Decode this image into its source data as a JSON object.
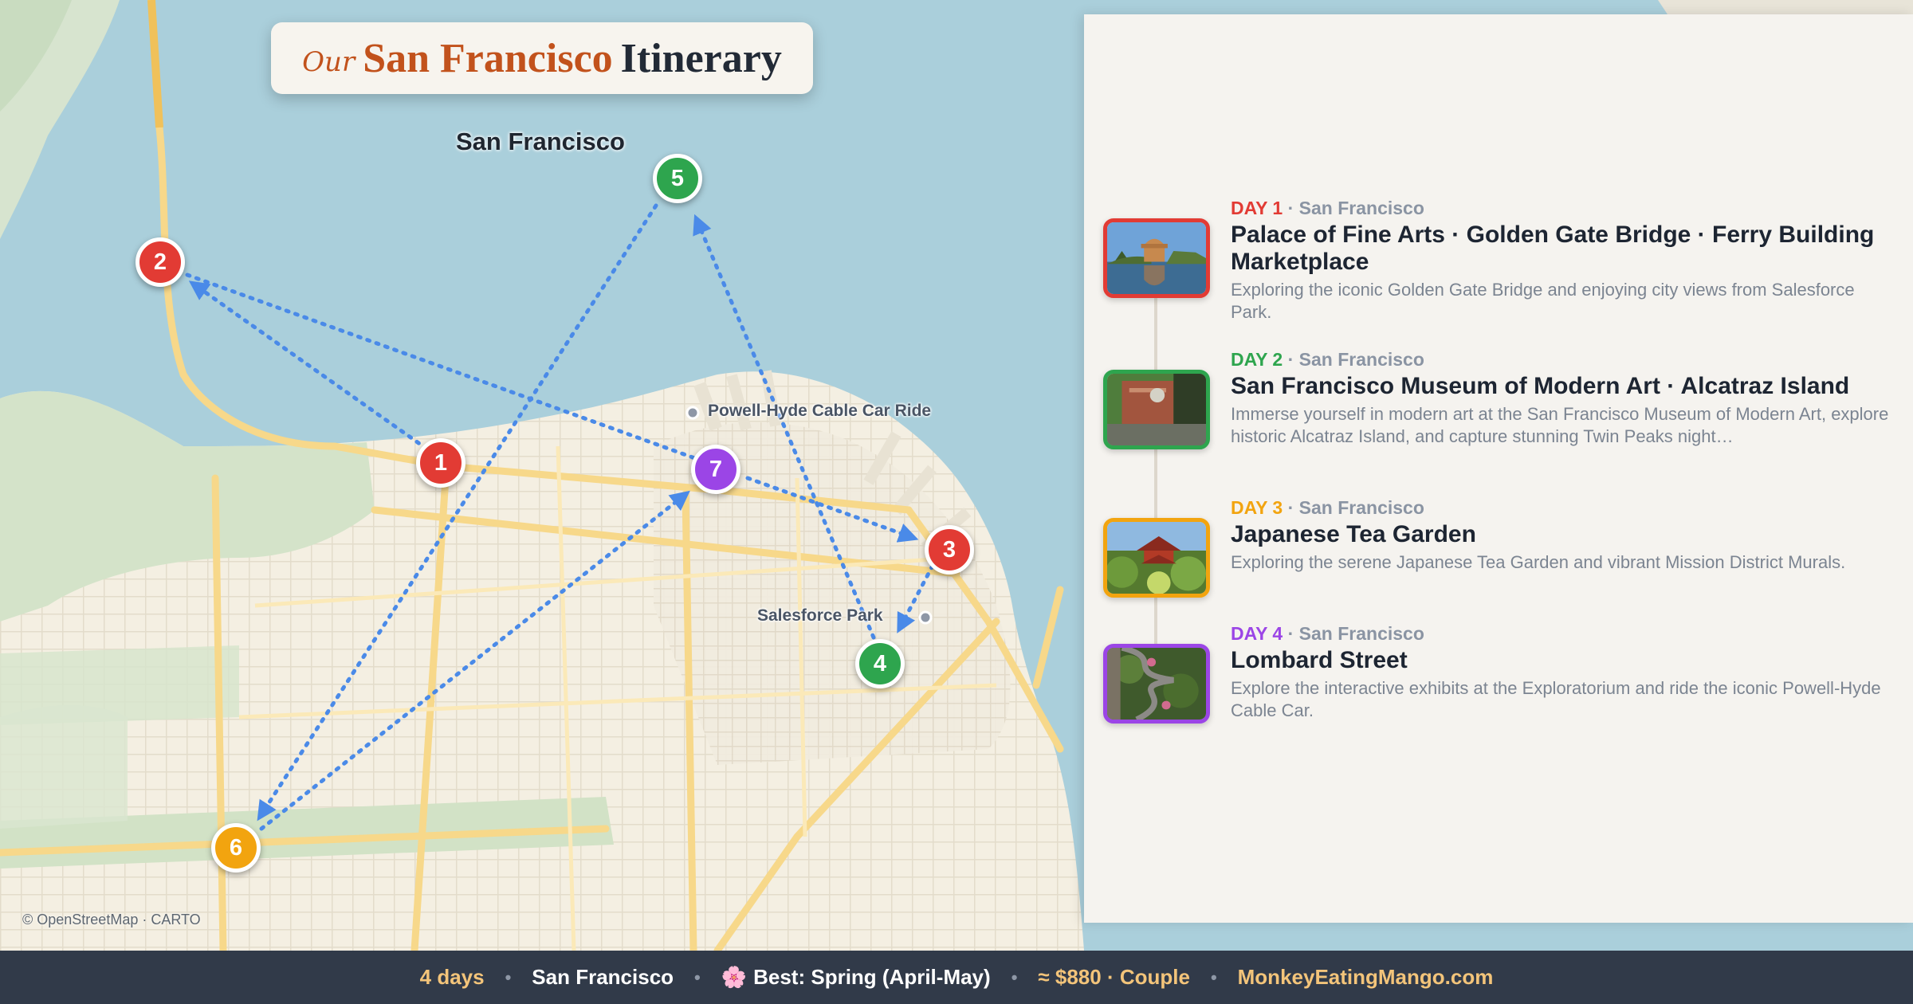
{
  "title": {
    "our": "Our",
    "city": "San Francisco",
    "word": "Itinerary"
  },
  "map": {
    "city_label": "San Francisco",
    "attribution": "© OpenStreetMap · CARTO",
    "poi": {
      "cable_car": "Powell-Hyde Cable Car Ride",
      "salesforce": "Salesforce Park"
    },
    "markers": [
      {
        "label": "1",
        "color": "#e23b34"
      },
      {
        "label": "2",
        "color": "#e23b34"
      },
      {
        "label": "3",
        "color": "#e23b34"
      },
      {
        "label": "4",
        "color": "#2ea54e"
      },
      {
        "label": "5",
        "color": "#2ea54e"
      },
      {
        "label": "6",
        "color": "#f2a40f"
      },
      {
        "label": "7",
        "color": "#9b45e6"
      }
    ],
    "route_color": "#4a8ae8"
  },
  "days": [
    {
      "label": "DAY 1",
      "sep": " · San Francisco",
      "color": "#e23b34",
      "title": "Palace of Fine Arts · Golden Gate Bridge · Ferry Building Marketplace",
      "desc": "Exploring the iconic Golden Gate Bridge and enjoying city views from Salesforce Park.",
      "thumb": "palace-of-fine-arts-photo"
    },
    {
      "label": "DAY 2",
      "sep": " · San Francisco",
      "color": "#2ea54e",
      "title": "San Francisco Museum of Modern Art · Alcatraz Island",
      "desc": "Immerse yourself in modern art at the San Francisco Museum of Modern Art, explore historic Alcatraz Island, and capture stunning Twin Peaks night…",
      "thumb": "museum-of-modern-art-photo"
    },
    {
      "label": "DAY 3",
      "sep": " · San Francisco",
      "color": "#f2a40f",
      "title": "Japanese Tea Garden",
      "desc": "Exploring the serene Japanese Tea Garden and vibrant Mission District Murals.",
      "thumb": "japanese-tea-garden-photo"
    },
    {
      "label": "DAY 4",
      "sep": " · San Francisco",
      "color": "#9b45e6",
      "title": "Lombard Street",
      "desc": "Explore the interactive exhibits at the Exploratorium and ride the iconic Powell-Hyde Cable Car.",
      "thumb": "lombard-street-photo"
    }
  ],
  "footer": {
    "days": "4 days",
    "city": "San Francisco",
    "flower": "🌸",
    "season": "Best: Spring (April-May)",
    "cost": "≈ $880 · Couple",
    "site": "MonkeyEatingMango.com",
    "dot": "•"
  }
}
